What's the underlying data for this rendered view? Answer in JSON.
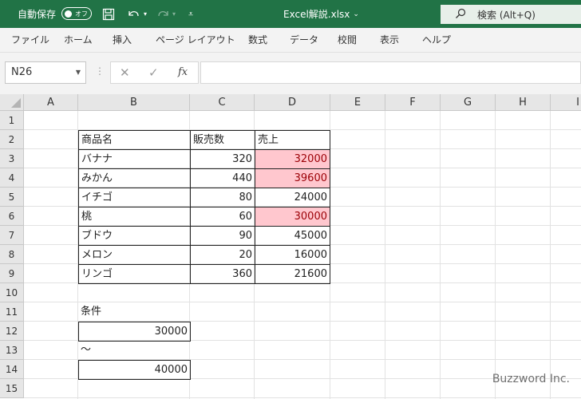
{
  "titlebar": {
    "autosave_label": "自動保存",
    "toggle_label": "オフ",
    "doc_title": "Excel解説.xlsx",
    "search_text": "検索 (Alt+Q)"
  },
  "menu": [
    "ファイル",
    "ホーム",
    "挿入",
    "ページ レイアウト",
    "数式",
    "データ",
    "校閲",
    "表示",
    "ヘルプ"
  ],
  "formula": {
    "name_box": "N26",
    "fx": "fx",
    "value": ""
  },
  "columns": [
    "A",
    "B",
    "C",
    "D",
    "E",
    "F",
    "G",
    "H",
    "I"
  ],
  "rows": [
    "1",
    "2",
    "3",
    "4",
    "5",
    "6",
    "7",
    "8",
    "9",
    "10",
    "11",
    "12",
    "13",
    "14",
    "15"
  ],
  "table": {
    "headers": [
      "商品名",
      "販売数",
      "売上"
    ],
    "rows": [
      [
        "バナナ",
        "320",
        "32000"
      ],
      [
        "みかん",
        "440",
        "39600"
      ],
      [
        "イチゴ",
        "80",
        "24000"
      ],
      [
        "桃",
        "60",
        "30000"
      ],
      [
        "ブドウ",
        "90",
        "45000"
      ],
      [
        "メロン",
        "20",
        "16000"
      ],
      [
        "リンゴ",
        "360",
        "21600"
      ]
    ],
    "highlighted_rows": [
      0,
      1,
      3
    ],
    "highlight_fill": "#ffc7ce",
    "highlight_text": "#9c0006"
  },
  "condition": {
    "label": "条件",
    "min": "30000",
    "tilde": "～",
    "max": "40000"
  },
  "watermark": "Buzzword Inc.",
  "colors": {
    "accent": "#217346"
  }
}
